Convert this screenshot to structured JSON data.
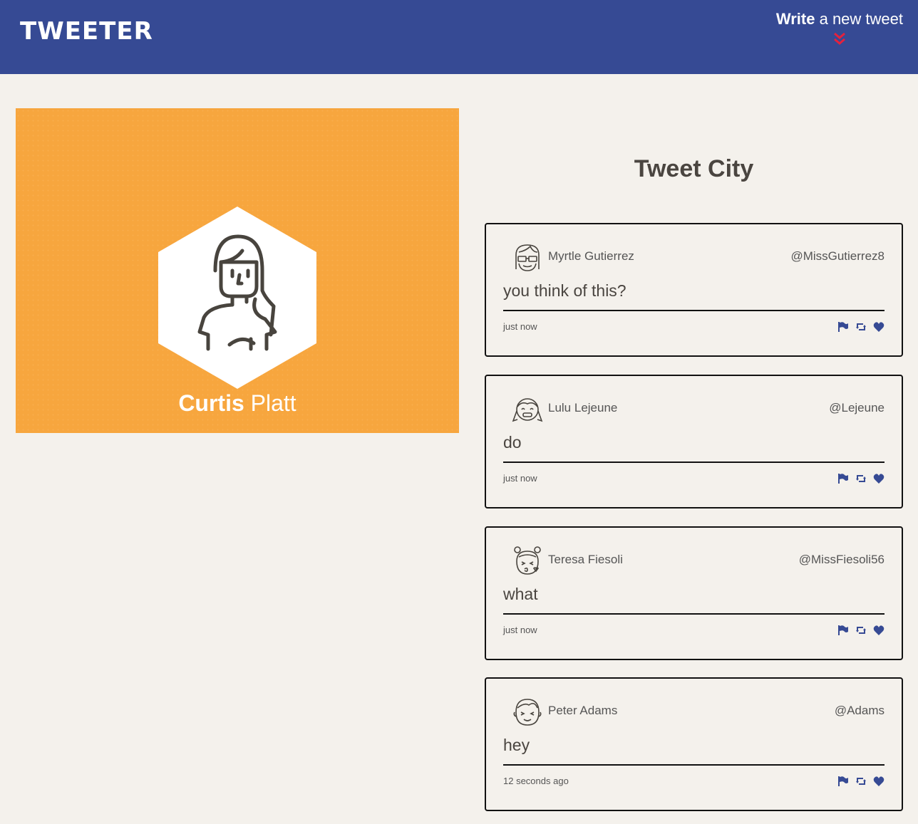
{
  "nav": {
    "logo": "TWEETER",
    "compose_bold": "Write",
    "compose_rest": " a new tweet",
    "compose_icon": "double-chevron-down-icon",
    "compose_icon_color": "#e5213d"
  },
  "colors": {
    "nav_bg": "#364a94",
    "page_bg": "#f4f1ec",
    "profile_bg": "#f7a63e",
    "action_icon": "#364a94"
  },
  "profile": {
    "first_name": "Curtis",
    "last_name": " Platt",
    "avatar_icon": "woman-avatar-icon"
  },
  "feed": {
    "title": "Tweet City",
    "tweets": [
      {
        "name": "Myrtle Gutierrez",
        "handle": "@MissGutierrez8",
        "content": "you think of this?",
        "time": "just now",
        "avatar_icon": "girl-glasses-avatar-icon"
      },
      {
        "name": "Lulu Lejeune",
        "handle": "@Lejeune",
        "content": "do",
        "time": "just now",
        "avatar_icon": "girl-pigtails-avatar-icon"
      },
      {
        "name": "Teresa Fiesoli",
        "handle": "@MissFiesoli56",
        "content": "what",
        "time": "just now",
        "avatar_icon": "girl-bun-avatar-icon"
      },
      {
        "name": "Peter Adams",
        "handle": "@Adams",
        "content": "hey",
        "time": "12 seconds ago",
        "avatar_icon": "boy-avatar-icon"
      }
    ],
    "action_icons": [
      "flag-icon",
      "retweet-icon",
      "heart-icon"
    ]
  }
}
